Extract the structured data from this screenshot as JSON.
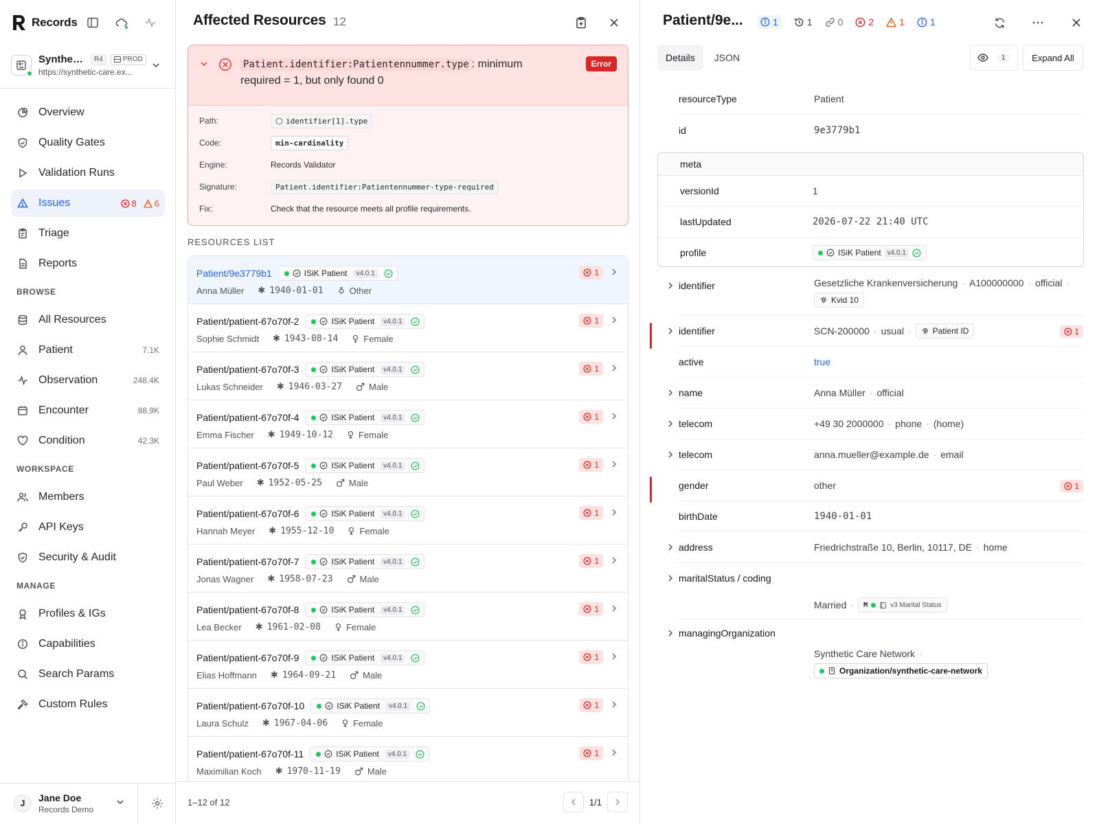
{
  "app": {
    "name": "Records"
  },
  "project": {
    "name": "Syntheti...",
    "fhir_version": "R4",
    "env": "PROD",
    "url": "https://synthetic-care.ex..."
  },
  "nav": {
    "main": [
      {
        "key": "overview",
        "label": "Overview"
      },
      {
        "key": "quality-gates",
        "label": "Quality Gates"
      },
      {
        "key": "validation-runs",
        "label": "Validation Runs"
      },
      {
        "key": "issues",
        "label": "Issues",
        "errors": "8",
        "warnings": "6"
      },
      {
        "key": "triage",
        "label": "Triage"
      },
      {
        "key": "reports",
        "label": "Reports"
      }
    ],
    "browse_title": "BROWSE",
    "browse": [
      {
        "label": "All Resources",
        "count": ""
      },
      {
        "label": "Patient",
        "count": "7.1K"
      },
      {
        "label": "Observation",
        "count": "248.4K"
      },
      {
        "label": "Encounter",
        "count": "88.9K"
      },
      {
        "label": "Condition",
        "count": "42.3K"
      }
    ],
    "workspace_title": "WORKSPACE",
    "workspace": [
      {
        "label": "Members"
      },
      {
        "label": "API Keys"
      },
      {
        "label": "Security & Audit"
      }
    ],
    "manage_title": "MANAGE",
    "manage": [
      {
        "label": "Profiles & IGs"
      },
      {
        "label": "Capabilities"
      },
      {
        "label": "Search Params"
      },
      {
        "label": "Custom Rules"
      }
    ]
  },
  "user": {
    "initial": "J",
    "name": "Jane Doe",
    "org": "Records Demo"
  },
  "middle": {
    "title": "Affected Resources",
    "count": "12",
    "issue": {
      "path_code": "Patient.identifier:Patientennummer.type",
      "message": ": minimum required = 1, but only found 0",
      "severity": "Error",
      "labels": {
        "path": "Path:",
        "code": "Code:",
        "engine": "Engine:",
        "signature": "Signature:",
        "fix": "Fix:"
      },
      "path": "identifier[1].type",
      "code": "min-cardinality",
      "engine": "Records Validator",
      "signature": "Patient.identifier:Patientennummer-type-required",
      "fix": "Check that the resource meets all profile requirements."
    },
    "list_title": "RESOURCES LIST",
    "resources": [
      {
        "id": "Patient/9e3779b1",
        "profile": "ISiK Patient",
        "version": "v4.0.1",
        "name": "Anna Müller",
        "birth": "1940-01-01",
        "gender": "Other",
        "g": "other",
        "errors": "1"
      },
      {
        "id": "Patient/patient-67o70f-2",
        "profile": "ISiK Patient",
        "version": "v4.0.1",
        "name": "Sophie Schmidt",
        "birth": "1943-08-14",
        "gender": "Female",
        "g": "female",
        "errors": "1"
      },
      {
        "id": "Patient/patient-67o70f-3",
        "profile": "ISiK Patient",
        "version": "v4.0.1",
        "name": "Lukas Schneider",
        "birth": "1946-03-27",
        "gender": "Male",
        "g": "male",
        "errors": "1"
      },
      {
        "id": "Patient/patient-67o70f-4",
        "profile": "ISiK Patient",
        "version": "v4.0.1",
        "name": "Emma Fischer",
        "birth": "1949-10-12",
        "gender": "Female",
        "g": "female",
        "errors": "1"
      },
      {
        "id": "Patient/patient-67o70f-5",
        "profile": "ISiK Patient",
        "version": "v4.0.1",
        "name": "Paul Weber",
        "birth": "1952-05-25",
        "gender": "Male",
        "g": "male",
        "errors": "1"
      },
      {
        "id": "Patient/patient-67o70f-6",
        "profile": "ISiK Patient",
        "version": "v4.0.1",
        "name": "Hannah Meyer",
        "birth": "1955-12-10",
        "gender": "Female",
        "g": "female",
        "errors": "1"
      },
      {
        "id": "Patient/patient-67o70f-7",
        "profile": "ISiK Patient",
        "version": "v4.0.1",
        "name": "Jonas Wagner",
        "birth": "1958-07-23",
        "gender": "Male",
        "g": "male",
        "errors": "1"
      },
      {
        "id": "Patient/patient-67o70f-8",
        "profile": "ISiK Patient",
        "version": "v4.0.1",
        "name": "Lea Becker",
        "birth": "1961-02-08",
        "gender": "Female",
        "g": "female",
        "errors": "1"
      },
      {
        "id": "Patient/patient-67o70f-9",
        "profile": "ISiK Patient",
        "version": "v4.0.1",
        "name": "Elias Hoffmann",
        "birth": "1964-09-21",
        "gender": "Male",
        "g": "male",
        "errors": "1"
      },
      {
        "id": "Patient/patient-67o70f-10",
        "profile": "ISiK Patient",
        "version": "v4.0.1",
        "name": "Laura Schulz",
        "birth": "1967-04-06",
        "gender": "Female",
        "g": "female",
        "errors": "1"
      },
      {
        "id": "Patient/patient-67o70f-11",
        "profile": "ISiK Patient",
        "version": "v4.0.1",
        "name": "Maximilian Koch",
        "birth": "1970-11-19",
        "gender": "Male",
        "g": "male",
        "errors": "1"
      }
    ],
    "range": "1–12 of 12",
    "page": "1/1"
  },
  "detail": {
    "title": "Patient/9e...",
    "stats": {
      "info_a": "1",
      "history": "1",
      "links": "0",
      "errors": "2",
      "warnings": "1",
      "info_b": "1"
    },
    "tabs": [
      "Details",
      "JSON"
    ],
    "eye_count": "1",
    "expand_label": "Expand All",
    "resourceType": {
      "key": "resourceType",
      "value": "Patient"
    },
    "id": {
      "key": "id",
      "value": "9e3779b1"
    },
    "meta": {
      "key": "meta",
      "versionId": {
        "key": "versionId",
        "value": "1"
      },
      "lastUpdated": {
        "key": "lastUpdated",
        "value": "2026-07-22 21:40 UTC"
      },
      "profile": {
        "key": "profile",
        "name": "ISiK Patient",
        "version": "v4.0.1"
      }
    },
    "identifier1": {
      "key": "identifier",
      "system": "Gesetzliche Krankenversicherung",
      "value": "A100000000",
      "use": "official",
      "type": "Kvid 10"
    },
    "identifier2": {
      "key": "identifier",
      "value": "SCN-200000",
      "use": "usual",
      "type": "Patient ID",
      "errors": "1"
    },
    "active": {
      "key": "active",
      "value": "true"
    },
    "name": {
      "key": "name",
      "value": "Anna Müller",
      "use": "official"
    },
    "telecom1": {
      "key": "telecom",
      "value": "+49 30 2000000",
      "system": "phone",
      "use": "(home)"
    },
    "telecom2": {
      "key": "telecom",
      "value": "anna.mueller@example.de",
      "system": "email"
    },
    "gender": {
      "key": "gender",
      "value": "other",
      "errors": "1"
    },
    "birthDate": {
      "key": "birthDate",
      "value": "1940-01-01"
    },
    "address": {
      "key": "address",
      "value": "Friedrichstraße 10, Berlin, 10117, DE",
      "use": "home"
    },
    "maritalStatus": {
      "key": "maritalStatus / coding",
      "display": "Married",
      "code": "M",
      "system": "v3 Marital Status"
    },
    "managingOrganization": {
      "key": "managingOrganization",
      "display": "Synthetic Care Network",
      "reference": "Organization/synthetic-care-network"
    }
  },
  "colors": {
    "accent": "#2563eb",
    "error": "#dc2626",
    "warning": "#ea580c",
    "ok": "#22c55e"
  }
}
